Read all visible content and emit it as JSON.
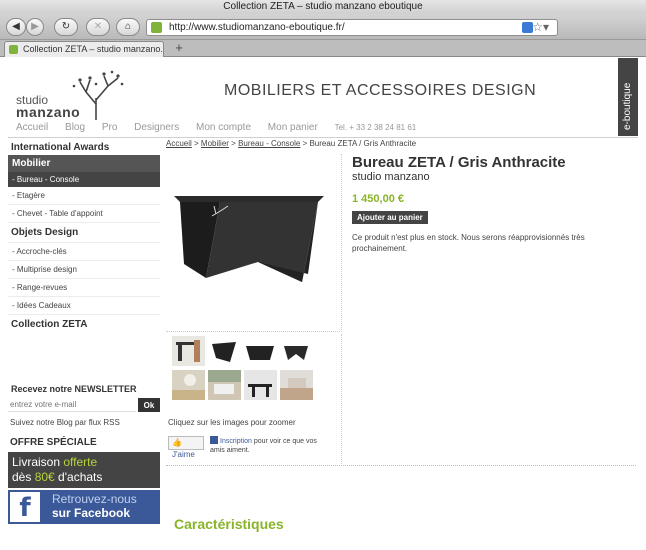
{
  "window": {
    "title": "Collection ZETA – studio manzano eboutique"
  },
  "toolbar": {
    "url": "http://www.studiomanzano-eboutique.fr/"
  },
  "tab": {
    "label": "Collection ZETA – studio manzano...",
    "new_tab": "+"
  },
  "header": {
    "logo_line1": "studio",
    "logo_line2": "manzano",
    "slogan": "MOBILIERS ET ACCESSOIRES DESIGN",
    "eboutique": "e-boutique",
    "nav": [
      "Accueil",
      "Blog",
      "Pro",
      "Designers",
      "Mon compte",
      "Mon panier"
    ],
    "phone": "Tel. + 33 2 38 24 81 61"
  },
  "sidebar": {
    "awards": "International Awards",
    "mobilier": "Mobilier",
    "mobilier_items": [
      "- Bureau - Console",
      "- Etagère",
      "- Chevet - Table d'appoint"
    ],
    "objets": "Objets Design",
    "objets_items": [
      "- Accroche-clés",
      "- Multiprise design",
      "- Range-revues",
      "- Idées Cadeaux"
    ],
    "collection": "Collection ZETA",
    "newsletter_title": "Recevez notre NEWSLETTER",
    "newsletter_placeholder": "entrez votre e-mail",
    "newsletter_ok": "Ok",
    "rss": "Suivez notre Blog par flux RSS",
    "offre": "OFFRE SPÉCIALE",
    "promo_1a": "Livraison ",
    "promo_1b": "offerte",
    "promo_2a": "dès ",
    "promo_2b": "80€",
    "promo_2c": " d'achats",
    "fb_line1": "Retrouvez-nous",
    "fb_line2": "sur Facebook"
  },
  "breadcrumb": {
    "home": "Accueil",
    "sep": " > ",
    "cat": "Mobilier",
    "sub": "Bureau - Console",
    "current": "Bureau ZETA / Gris Anthracite"
  },
  "product": {
    "title": "Bureau ZETA / Gris Anthracite",
    "brand": "studio manzano",
    "price": "1 450,00 €",
    "add_to_cart": "Ajouter au panier",
    "stock": "Ce produit n'est plus en stock. Nous serons réapprovisionnés très prochainement.",
    "zoom_hint": "Cliquez sur les images pour zoomer",
    "like": "J'aime",
    "fb_link": "Inscription",
    "fb_text": " pour voir ce que vos amis aiment."
  },
  "section": {
    "caracteristiques": "Caractéristiques"
  }
}
